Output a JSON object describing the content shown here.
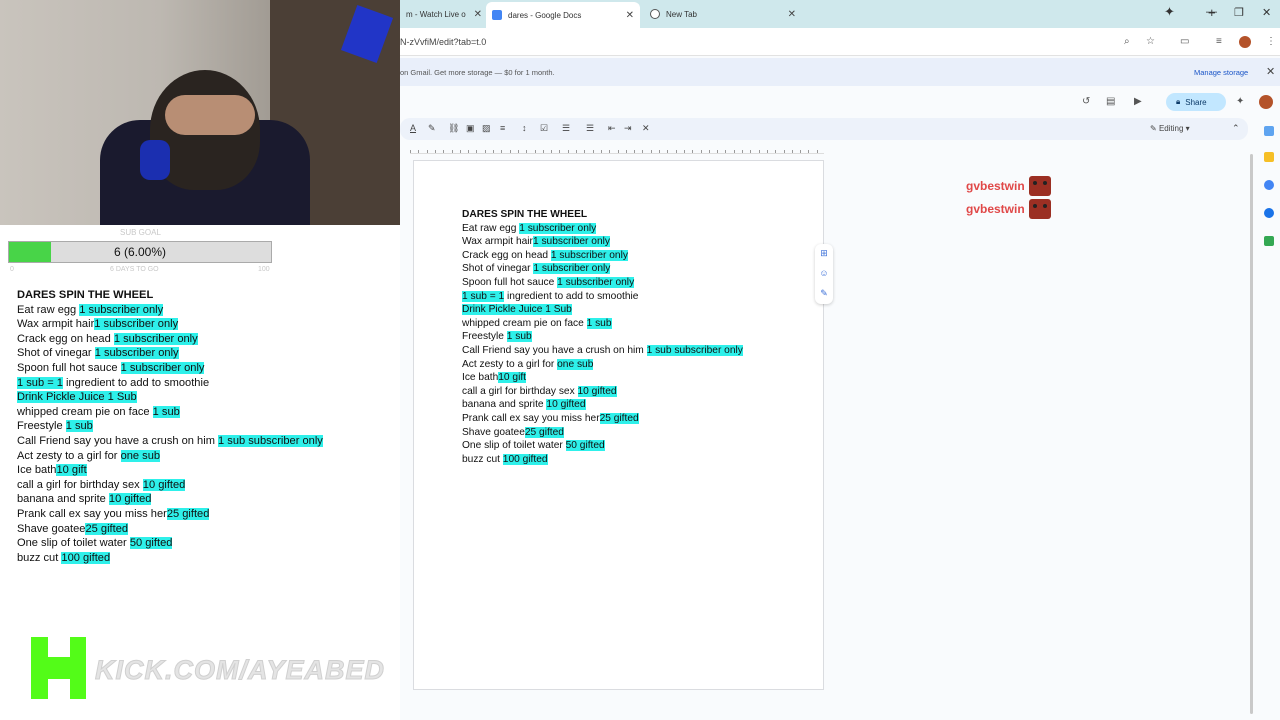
{
  "browser": {
    "tabs": [
      {
        "label": "m - Watch Live o",
        "icon_color": "#e33b2e"
      },
      {
        "label": "dares - Google Docs",
        "icon_color": "#4285f4"
      },
      {
        "label": "New Tab",
        "icon_color": "#555555"
      }
    ],
    "url": "N-zVvfiM/edit?tab=t.0",
    "new_tab_symbol": "+"
  },
  "banner": {
    "text": "on Gmail. Get more storage — $0 for 1 month.",
    "manage_label": "Manage storage"
  },
  "docs": {
    "share_label": "Share",
    "mode_label": "Editing",
    "lines": [
      {
        "text": "DARES SPIN THE WHEEL",
        "hl": "",
        "bold": true
      },
      {
        "text": "Eat raw egg ",
        "hl": "1 subscriber only"
      },
      {
        "text": "Wax armpit hair",
        "hl": "1 subscriber only"
      },
      {
        "text": "Crack egg on head ",
        "hl": "1 subscriber only"
      },
      {
        "text": "Shot of vinegar ",
        "hl": "1 subscriber only"
      },
      {
        "text": " Spoon full hot sauce ",
        "hl": "1 subscriber only"
      },
      {
        "text": "",
        "hl": "1 sub = 1",
        "tail": " ingredient to add to smoothie"
      },
      {
        "text": "",
        "hl": "Drink Pickle Juice 1 Sub"
      },
      {
        "text": "whipped cream pie on face ",
        "hl": "1 sub"
      },
      {
        "text": "Freestyle ",
        "hl": "1 sub"
      },
      {
        "text": "Call Friend say you have a crush on him ",
        "hl": "1 sub subscriber only"
      },
      {
        "text": "Act zesty to a girl for ",
        "hl": "one sub"
      },
      {
        "text": "Ice bath",
        "hl": "10 gift"
      },
      {
        "text": "call a girl for birthday sex ",
        "hl": "10 gifted"
      },
      {
        "text": " banana and sprite ",
        "hl": "10 gifted"
      },
      {
        "text": "Prank call ex say you miss her",
        "hl": "25 gifted"
      },
      {
        "text": "Shave goatee",
        "hl": "25 gifted"
      },
      {
        "text": "One slip of toilet water ",
        "hl": "50 gifted"
      },
      {
        "text": "buzz cut ",
        "hl": "100 gifted"
      }
    ]
  },
  "chat": [
    {
      "name": "gvbestwin"
    },
    {
      "name": "gvbestwin"
    }
  ],
  "stream": {
    "goal_label": "SUB GOAL",
    "goal_text": "6 (6.00%)",
    "goal_progress": 0.06,
    "goal_sub_left": "0",
    "goal_sub_mid": "6 DAYS TO GO",
    "goal_sub_right": "100",
    "kick_url": "KICK.COM/AYEABED"
  },
  "colors": {
    "highlight": "#2ef0ea",
    "chat_name": "#e04848",
    "kick_green": "#53fc18"
  }
}
